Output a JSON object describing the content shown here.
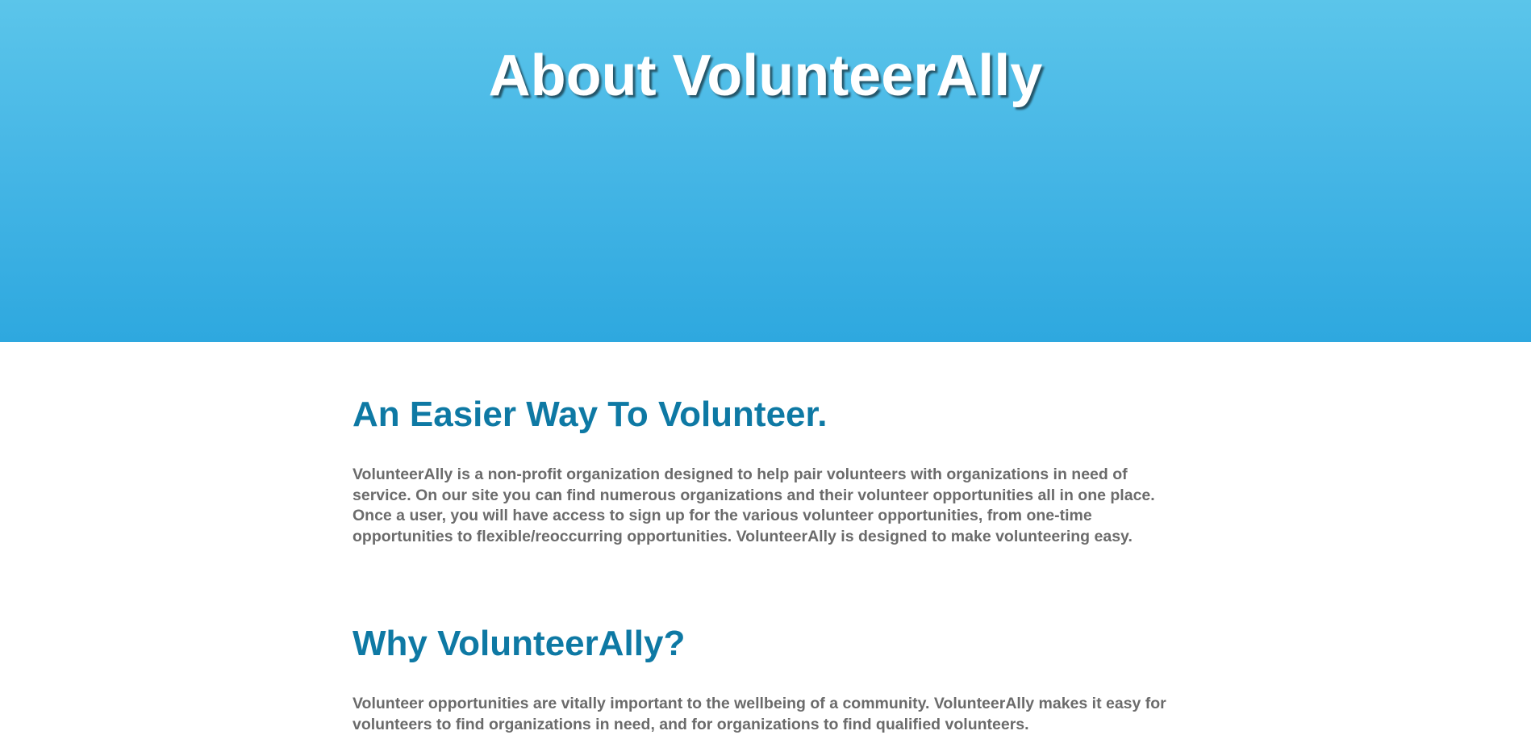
{
  "hero": {
    "title": "About VolunteerAlly"
  },
  "sections": [
    {
      "heading": "An Easier Way To Volunteer.",
      "body": "VolunteerAlly is a non-profit organization designed to help pair volunteers with organizations in need of service. On our site you can find numerous organizations and their volunteer opportunities all in one place. Once a user, you will have access to sign up for the various volunteer opportunities, from one-time opportunities to flexible/reoccurring opportunities. VolunteerAlly is designed to make volunteering easy."
    },
    {
      "heading": "Why VolunteerAlly?",
      "body": "Volunteer opportunities are vitally important to the wellbeing of a community. VolunteerAlly makes it easy for volunteers to find organizations in need, and for organizations to find qualified volunteers."
    }
  ],
  "colors": {
    "hero_gradient_top": "#5bc5ea",
    "hero_gradient_bottom": "#2ea8df",
    "heading": "#0e79a4",
    "body_text": "#6b6b6b"
  }
}
